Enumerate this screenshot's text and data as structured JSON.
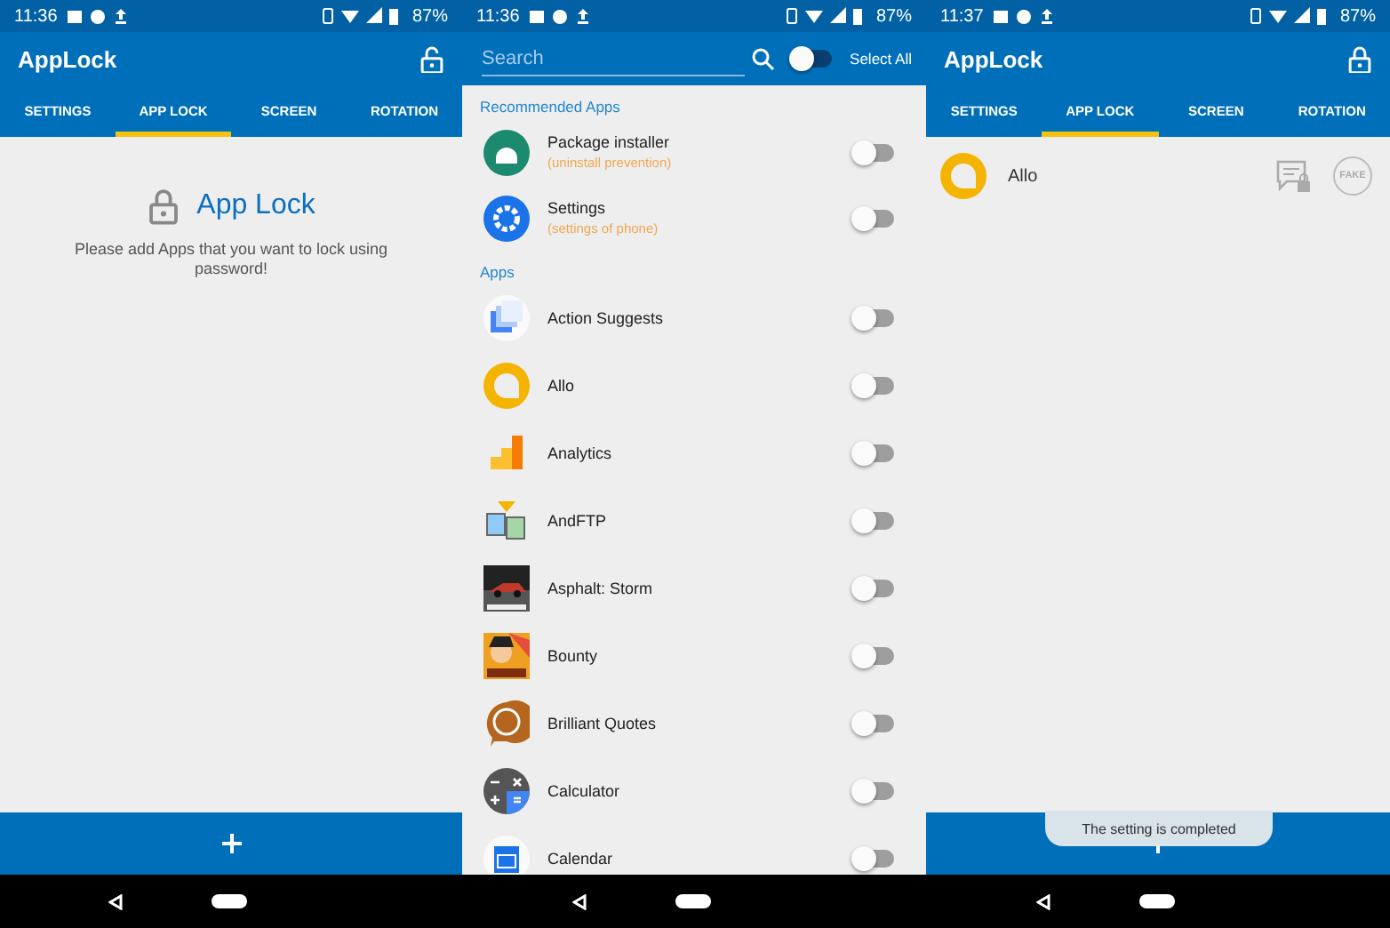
{
  "screens": [
    {
      "kind": "home",
      "status": {
        "time": "11:36",
        "battery": "87%"
      },
      "title": "AppLock",
      "lock_closed": false,
      "tabs": [
        {
          "label": "SETTINGS",
          "selected": false
        },
        {
          "label": "APP LOCK",
          "selected": true
        },
        {
          "label": "SCREEN",
          "selected": false
        },
        {
          "label": "ROTATION",
          "selected": false
        }
      ],
      "empty": {
        "heading": "App Lock",
        "message": "Please add Apps that you want to lock using password!"
      }
    },
    {
      "kind": "picker",
      "status": {
        "time": "11:36",
        "battery": "87%"
      },
      "search": {
        "placeholder": "Search"
      },
      "select_all": {
        "label": "Select All",
        "on": false
      },
      "sections": [
        {
          "title": "Recommended Apps",
          "apps": [
            {
              "name": "Package installer",
              "note": "(uninstall prevention)",
              "on": false
            },
            {
              "name": "Settings",
              "note": "(settings of phone)",
              "on": false
            }
          ]
        },
        {
          "title": "Apps",
          "apps": [
            {
              "name": "Action Suggests",
              "on": false
            },
            {
              "name": "Allo",
              "on": false
            },
            {
              "name": "Analytics",
              "on": false
            },
            {
              "name": "AndFTP",
              "on": false
            },
            {
              "name": "Asphalt: Storm",
              "on": false
            },
            {
              "name": "Bounty",
              "on": false
            },
            {
              "name": "Brilliant Quotes",
              "on": false
            },
            {
              "name": "Calculator",
              "on": false
            },
            {
              "name": "Calendar",
              "on": false
            }
          ]
        }
      ]
    },
    {
      "kind": "locked",
      "status": {
        "time": "11:37",
        "battery": "87%"
      },
      "title": "AppLock",
      "lock_closed": true,
      "tabs": [
        {
          "label": "SETTINGS",
          "selected": false
        },
        {
          "label": "APP LOCK",
          "selected": true
        },
        {
          "label": "SCREEN",
          "selected": false
        },
        {
          "label": "ROTATION",
          "selected": false
        }
      ],
      "apps": [
        {
          "name": "Allo",
          "fake_label": "FAKE"
        }
      ],
      "toast": "The setting is completed"
    }
  ]
}
